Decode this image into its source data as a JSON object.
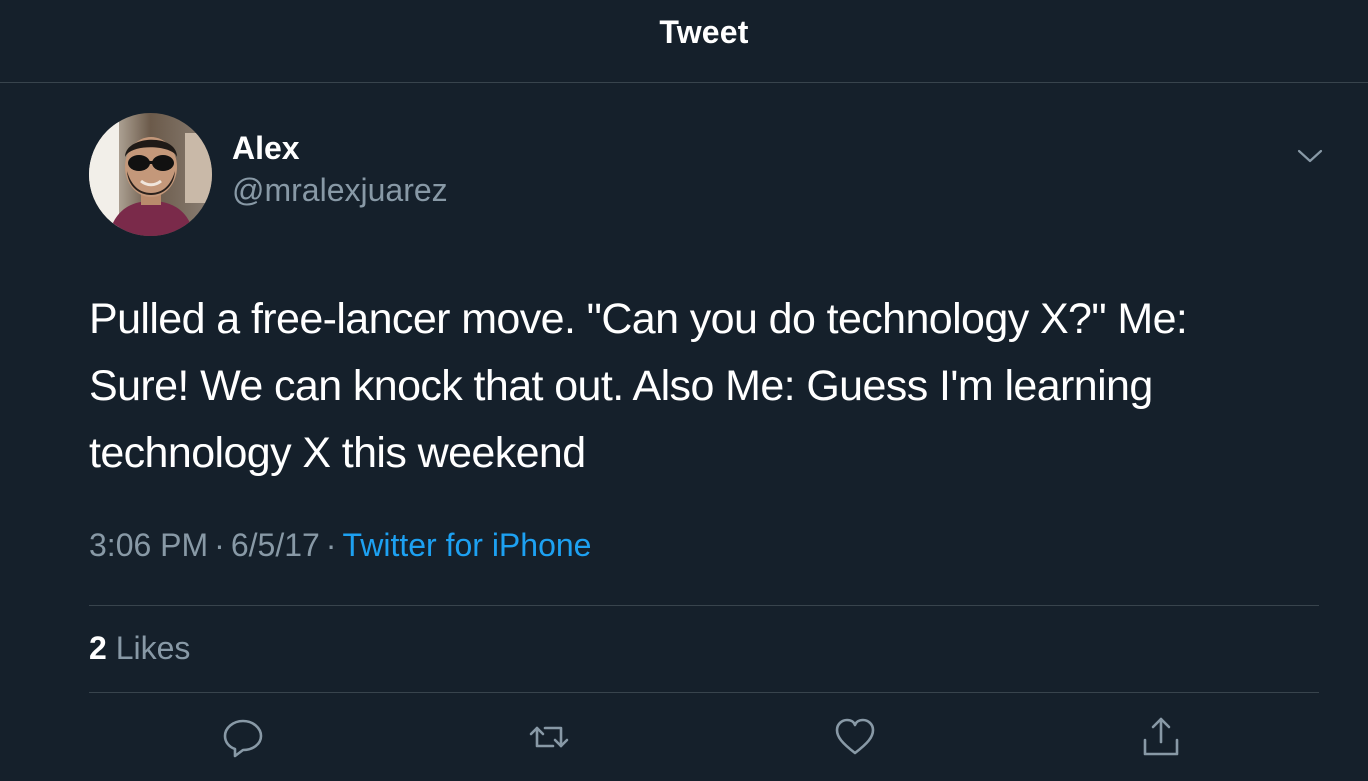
{
  "header": {
    "title": "Tweet"
  },
  "tweet": {
    "author": {
      "name": "Alex",
      "handle": "@mralexjuarez",
      "avatar_icon": "user-avatar"
    },
    "text": "Pulled a free-lancer move. \"Can you do technology X?\" Me: Sure! We can knock that out. Also Me: Guess I'm learning technology X this weekend",
    "time": "3:06 PM",
    "date": "6/5/17",
    "separator": "·",
    "source": "Twitter for iPhone",
    "likes": {
      "count": "2",
      "label": "Likes"
    }
  },
  "actions": [
    {
      "icon": "reply-icon"
    },
    {
      "icon": "retweet-icon"
    },
    {
      "icon": "heart-icon"
    },
    {
      "icon": "share-icon"
    }
  ],
  "colors": {
    "background": "#15202b",
    "divider": "#38444d",
    "secondary_text": "#8899a6",
    "link": "#1da1f2",
    "primary_text": "#ffffff"
  }
}
